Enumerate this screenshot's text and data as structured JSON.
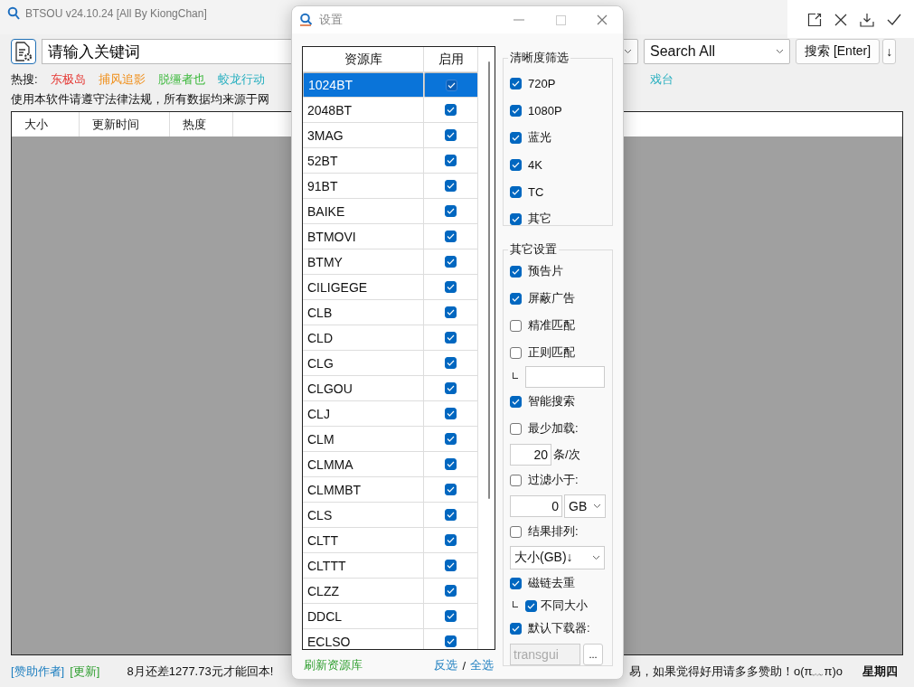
{
  "window": {
    "title": "BTSOU v24.10.24 [All By KiongChan]"
  },
  "toolbar": {
    "keyword": "请输入关键词",
    "scope": "Search All",
    "search_button": "搜索 [Enter]",
    "sort_button": "↓"
  },
  "hot": {
    "label": "热搜:",
    "items": [
      {
        "text": "东极岛",
        "color": "#e53935"
      },
      {
        "text": "捕风追影",
        "color": "#f0901c"
      },
      {
        "text": "脱缰者也",
        "color": "#3cb83c"
      },
      {
        "text": "蛟龙行动",
        "color": "#2ab0c0"
      }
    ],
    "right_items": [
      {
        "text": "戏台",
        "color": "#2ab0c0"
      }
    ]
  },
  "notice": "使用本软件请遵守法律法规，所有数据均来源于网",
  "table": {
    "columns": [
      "大小",
      "更新时间",
      "热度"
    ]
  },
  "status_bar": {
    "links": [
      {
        "text": "[赞助作者]",
        "color": "#1e7fc0"
      },
      {
        "text": "[更新]",
        "color": "#2e9e2e"
      }
    ],
    "message_left": "8月还差1277.73元才能回本!",
    "message_right": "易，如果觉得好用请多多赞助！o(π﹏π)o",
    "day": "星期四"
  },
  "dialog": {
    "title": "设置",
    "sources": {
      "columns": [
        "资源库",
        "启用"
      ],
      "rows": [
        {
          "name": "1024BT",
          "enabled": true,
          "selected": true
        },
        {
          "name": "2048BT",
          "enabled": true,
          "selected": false
        },
        {
          "name": "3MAG",
          "enabled": true,
          "selected": false
        },
        {
          "name": "52BT",
          "enabled": true,
          "selected": false
        },
        {
          "name": "91BT",
          "enabled": true,
          "selected": false
        },
        {
          "name": "BAIKE",
          "enabled": true,
          "selected": false
        },
        {
          "name": "BTMOVI",
          "enabled": true,
          "selected": false
        },
        {
          "name": "BTMY",
          "enabled": true,
          "selected": false
        },
        {
          "name": "CILIGEGE",
          "enabled": true,
          "selected": false
        },
        {
          "name": "CLB",
          "enabled": true,
          "selected": false
        },
        {
          "name": "CLD",
          "enabled": true,
          "selected": false
        },
        {
          "name": "CLG",
          "enabled": true,
          "selected": false
        },
        {
          "name": "CLGOU",
          "enabled": true,
          "selected": false
        },
        {
          "name": "CLJ",
          "enabled": true,
          "selected": false
        },
        {
          "name": "CLM",
          "enabled": true,
          "selected": false
        },
        {
          "name": "CLMMA",
          "enabled": true,
          "selected": false
        },
        {
          "name": "CLMMBT",
          "enabled": true,
          "selected": false
        },
        {
          "name": "CLS",
          "enabled": true,
          "selected": false
        },
        {
          "name": "CLTT",
          "enabled": true,
          "selected": false
        },
        {
          "name": "CLTTT",
          "enabled": true,
          "selected": false
        },
        {
          "name": "CLZZ",
          "enabled": true,
          "selected": false
        },
        {
          "name": "DDCL",
          "enabled": true,
          "selected": false
        },
        {
          "name": "ECLSO",
          "enabled": true,
          "selected": false
        }
      ]
    },
    "refresh": "刷新资源库",
    "invert": "反选",
    "separator": "/",
    "select_all": "全选",
    "quality": {
      "title": "清晰度筛选",
      "options": [
        {
          "label": "720P",
          "checked": true
        },
        {
          "label": "1080P",
          "checked": true
        },
        {
          "label": "蓝光",
          "checked": true
        },
        {
          "label": "4K",
          "checked": true
        },
        {
          "label": "TC",
          "checked": true
        },
        {
          "label": "其它",
          "checked": true
        }
      ]
    },
    "other": {
      "title": "其它设置",
      "rows": [
        {
          "kind": "check",
          "label": "预告片",
          "checked": true
        },
        {
          "kind": "check",
          "label": "屏蔽广告",
          "checked": true
        },
        {
          "kind": "check",
          "label": "精准匹配",
          "checked": false
        },
        {
          "kind": "check",
          "label": "正则匹配",
          "checked": false
        },
        {
          "kind": "field"
        },
        {
          "kind": "check",
          "label": "智能搜索",
          "checked": true
        },
        {
          "kind": "check",
          "label": "最少加载:",
          "checked": false
        },
        {
          "kind": "number_unit",
          "value": "20",
          "unit": "条/次"
        },
        {
          "kind": "check",
          "label": "过滤小于:",
          "checked": false
        },
        {
          "kind": "number_select",
          "value": "0",
          "unit": "GB"
        },
        {
          "kind": "check",
          "label": "结果排列:",
          "checked": false
        },
        {
          "kind": "select",
          "value": "大小(GB)↓"
        },
        {
          "kind": "check",
          "label": "磁链去重",
          "checked": true
        },
        {
          "kind": "subcheck",
          "label": "不同大小",
          "checked": true
        },
        {
          "kind": "check",
          "label": "默认下载器:",
          "checked": true
        },
        {
          "kind": "path",
          "value": "transgui",
          "disabled": true,
          "button": "..."
        }
      ]
    }
  }
}
